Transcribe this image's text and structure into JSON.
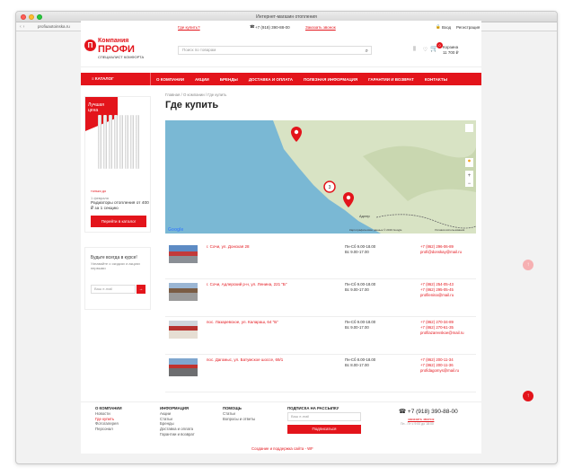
{
  "browser": {
    "title": "Интернет-магазин отопления",
    "url": "profiuaotoinska.ru"
  },
  "topbar": {
    "where_to_buy": "Где купить?",
    "phone": "+7 (918) 390-88-00",
    "callback": "Заказать звонок",
    "login": "Вход",
    "register": "Регистрация"
  },
  "logo": {
    "badge": "П",
    "line1": "Компания",
    "line2": "ПРОФИ",
    "line3": "СПЕЦИАЛИСТ КОМФОРТА"
  },
  "search": {
    "placeholder": "Поиск по товарам"
  },
  "cart": {
    "count": "0",
    "label": "Корзина",
    "total": "11 700 ₽"
  },
  "menu": {
    "catalog": "КАТАЛОГ",
    "items": [
      "О КОМПАНИИ",
      "АКЦИИ",
      "БРЕНДЫ",
      "ДОСТАВКА И ОПЛАТА",
      "ПОЛЕЗНАЯ ИНФОРМАЦИЯ",
      "ГАРАНТИИ И ВОЗВРАТ",
      "КОНТАКТЫ"
    ]
  },
  "promo": {
    "flag": "Лучшая цена",
    "small": "только до",
    "date": "1 февраля",
    "text": "Радиаторы отопления от 400 ₽ за 1 секцию",
    "button": "Перейти в каталог"
  },
  "subscribe_box": {
    "title": "Будьте всегда в курсе!",
    "text": "Узнавайте о скидках и акциях первыми",
    "placeholder": "Ваш e-mail",
    "button_icon": "arrow-right"
  },
  "breadcrumb": [
    "Главная",
    "О компании",
    "Где купить"
  ],
  "page_title": "Где купить",
  "map": {
    "attribution": "Картографические данные © 2019 Google",
    "google": "Google",
    "cluster_count": "3",
    "terms": "Условия использования",
    "city_label": "Адлер",
    "colors": {
      "sea": "#7ab8d4",
      "land": "#d8e3c4",
      "pin": "#e3141b"
    }
  },
  "stores": [
    {
      "address": "г. Сочи, ул. Донская 28",
      "hours": [
        "Пн-Сб 9.00-18.00",
        "Вс 9.00-17.00"
      ],
      "contacts": [
        "+7 (862) 296-06-89",
        "profi@donskay@mail.ru"
      ]
    },
    {
      "address": "г. Сочи, Адлерский р-н, ул. Ленина, 221 \"Б\"",
      "hours": [
        "Пн-Сб 9.00-18.00",
        "Вс 9.00-17.00"
      ],
      "contacts": [
        "+7 (862) 254-05-43",
        "+7 (862) 295-05-45",
        "profilenina@mail.ru"
      ]
    },
    {
      "address": "пос. Лазаревское, ул. Калараш, 64 \"Б\"",
      "hours": [
        "Пн-Сб 9.00-18.00",
        "Вс 9.00-17.00"
      ],
      "contacts": [
        "+7 (862) 270-34-89",
        "+7 (862) 270-61-35",
        "profilazarevskoe@mail.ru"
      ]
    },
    {
      "address": "пос. Дагомыс, ул. Батумское шоссе, 69/1",
      "hours": [
        "Пн-Сб 8.00-18.00",
        "Вс 8.00-17.00"
      ],
      "contacts": [
        "+7 (862) 200-11-34",
        "+7 (862) 200-11-36",
        "profidagomys@mail.ru"
      ]
    }
  ],
  "footer": {
    "about": {
      "title": "О КОМПАНИИ",
      "links": [
        "Новости",
        "Где купить",
        "Фотогалерея",
        "Персонал"
      ]
    },
    "info": {
      "title": "ИНФОРМАЦИЯ",
      "links": [
        "Акции",
        "Статьи",
        "Бренды",
        "Доставка и оплата",
        "Гарантии и возврат"
      ]
    },
    "help": {
      "title": "ПОМОЩЬ",
      "links": [
        "Статьи",
        "Вопросы и ответы"
      ]
    },
    "newsletter": {
      "title": "ПОДПИСКА НА РАССЫЛКУ",
      "placeholder": "Ваш e-mail",
      "button": "Подписаться"
    },
    "phone": "+7 (918) 390-88-00",
    "callback": "заказать звонок",
    "hours": "Пн - Пт с 9:00 до 18:00",
    "credits": "Создание и поддержка сайта - WF"
  },
  "accent_color": "#e3141b"
}
